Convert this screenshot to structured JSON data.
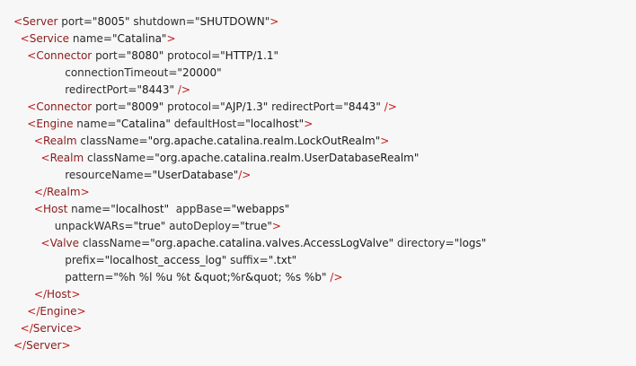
{
  "colors": {
    "background": "#f7f7f7",
    "bracket": "#c01a1a",
    "tag": "#8b1c1c",
    "attribute": "#2c2c2c",
    "value": "#1a1a1a"
  },
  "code": {
    "lines": [
      [
        {
          "t": "bracket",
          "v": "<"
        },
        {
          "t": "tag",
          "v": "Server"
        },
        {
          "t": "text",
          "v": " "
        },
        {
          "t": "attr",
          "v": "port"
        },
        {
          "t": "eq",
          "v": "="
        },
        {
          "t": "value",
          "v": "\"8005\""
        },
        {
          "t": "text",
          "v": " "
        },
        {
          "t": "attr",
          "v": "shutdown"
        },
        {
          "t": "eq",
          "v": "="
        },
        {
          "t": "value",
          "v": "\"SHUTDOWN\""
        },
        {
          "t": "bracket",
          "v": ">"
        }
      ],
      [
        {
          "t": "text",
          "v": "  "
        },
        {
          "t": "bracket",
          "v": "<"
        },
        {
          "t": "tag",
          "v": "Service"
        },
        {
          "t": "text",
          "v": " "
        },
        {
          "t": "attr",
          "v": "name"
        },
        {
          "t": "eq",
          "v": "="
        },
        {
          "t": "value",
          "v": "\"Catalina\""
        },
        {
          "t": "bracket",
          "v": ">"
        }
      ],
      [
        {
          "t": "text",
          "v": "    "
        },
        {
          "t": "bracket",
          "v": "<"
        },
        {
          "t": "tag",
          "v": "Connector"
        },
        {
          "t": "text",
          "v": " "
        },
        {
          "t": "attr",
          "v": "port"
        },
        {
          "t": "eq",
          "v": "="
        },
        {
          "t": "value",
          "v": "\"8080\""
        },
        {
          "t": "text",
          "v": " "
        },
        {
          "t": "attr",
          "v": "protocol"
        },
        {
          "t": "eq",
          "v": "="
        },
        {
          "t": "value",
          "v": "\"HTTP/1.1\""
        }
      ],
      [
        {
          "t": "text",
          "v": "               "
        },
        {
          "t": "attr",
          "v": "connectionTimeout"
        },
        {
          "t": "eq",
          "v": "="
        },
        {
          "t": "value",
          "v": "\"20000\""
        }
      ],
      [
        {
          "t": "text",
          "v": "               "
        },
        {
          "t": "attr",
          "v": "redirectPort"
        },
        {
          "t": "eq",
          "v": "="
        },
        {
          "t": "value",
          "v": "\"8443\""
        },
        {
          "t": "text",
          "v": " "
        },
        {
          "t": "bracket",
          "v": "/>"
        }
      ],
      [
        {
          "t": "text",
          "v": "    "
        },
        {
          "t": "bracket",
          "v": "<"
        },
        {
          "t": "tag",
          "v": "Connector"
        },
        {
          "t": "text",
          "v": " "
        },
        {
          "t": "attr",
          "v": "port"
        },
        {
          "t": "eq",
          "v": "="
        },
        {
          "t": "value",
          "v": "\"8009\""
        },
        {
          "t": "text",
          "v": " "
        },
        {
          "t": "attr",
          "v": "protocol"
        },
        {
          "t": "eq",
          "v": "="
        },
        {
          "t": "value",
          "v": "\"AJP/1.3\""
        },
        {
          "t": "text",
          "v": " "
        },
        {
          "t": "attr",
          "v": "redirectPort"
        },
        {
          "t": "eq",
          "v": "="
        },
        {
          "t": "value",
          "v": "\"8443\""
        },
        {
          "t": "text",
          "v": " "
        },
        {
          "t": "bracket",
          "v": "/>"
        }
      ],
      [
        {
          "t": "text",
          "v": "    "
        },
        {
          "t": "bracket",
          "v": "<"
        },
        {
          "t": "tag",
          "v": "Engine"
        },
        {
          "t": "text",
          "v": " "
        },
        {
          "t": "attr",
          "v": "name"
        },
        {
          "t": "eq",
          "v": "="
        },
        {
          "t": "value",
          "v": "\"Catalina\""
        },
        {
          "t": "text",
          "v": " "
        },
        {
          "t": "attr",
          "v": "defaultHost"
        },
        {
          "t": "eq",
          "v": "="
        },
        {
          "t": "value",
          "v": "\"localhost\""
        },
        {
          "t": "bracket",
          "v": ">"
        }
      ],
      [
        {
          "t": "text",
          "v": "      "
        },
        {
          "t": "bracket",
          "v": "<"
        },
        {
          "t": "tag",
          "v": "Realm"
        },
        {
          "t": "text",
          "v": " "
        },
        {
          "t": "attr",
          "v": "className"
        },
        {
          "t": "eq",
          "v": "="
        },
        {
          "t": "value",
          "v": "\"org.apache.catalina.realm.LockOutRealm\""
        },
        {
          "t": "bracket",
          "v": ">"
        }
      ],
      [
        {
          "t": "text",
          "v": "        "
        },
        {
          "t": "bracket",
          "v": "<"
        },
        {
          "t": "tag",
          "v": "Realm"
        },
        {
          "t": "text",
          "v": " "
        },
        {
          "t": "attr",
          "v": "className"
        },
        {
          "t": "eq",
          "v": "="
        },
        {
          "t": "value",
          "v": "\"org.apache.catalina.realm.UserDatabaseRealm\""
        }
      ],
      [
        {
          "t": "text",
          "v": "               "
        },
        {
          "t": "attr",
          "v": "resourceName"
        },
        {
          "t": "eq",
          "v": "="
        },
        {
          "t": "value",
          "v": "\"UserDatabase\""
        },
        {
          "t": "bracket",
          "v": "/>"
        }
      ],
      [
        {
          "t": "text",
          "v": "      "
        },
        {
          "t": "bracket",
          "v": "</"
        },
        {
          "t": "tag",
          "v": "Realm"
        },
        {
          "t": "bracket",
          "v": ">"
        }
      ],
      [
        {
          "t": "text",
          "v": "      "
        },
        {
          "t": "bracket",
          "v": "<"
        },
        {
          "t": "tag",
          "v": "Host"
        },
        {
          "t": "text",
          "v": " "
        },
        {
          "t": "attr",
          "v": "name"
        },
        {
          "t": "eq",
          "v": "="
        },
        {
          "t": "value",
          "v": "\"localhost\""
        },
        {
          "t": "text",
          "v": "  "
        },
        {
          "t": "attr",
          "v": "appBase"
        },
        {
          "t": "eq",
          "v": "="
        },
        {
          "t": "value",
          "v": "\"webapps\""
        }
      ],
      [
        {
          "t": "text",
          "v": "            "
        },
        {
          "t": "attr",
          "v": "unpackWARs"
        },
        {
          "t": "eq",
          "v": "="
        },
        {
          "t": "value",
          "v": "\"true\""
        },
        {
          "t": "text",
          "v": " "
        },
        {
          "t": "attr",
          "v": "autoDeploy"
        },
        {
          "t": "eq",
          "v": "="
        },
        {
          "t": "value",
          "v": "\"true\""
        },
        {
          "t": "bracket",
          "v": ">"
        }
      ],
      [
        {
          "t": "text",
          "v": "        "
        },
        {
          "t": "bracket",
          "v": "<"
        },
        {
          "t": "tag",
          "v": "Valve"
        },
        {
          "t": "text",
          "v": " "
        },
        {
          "t": "attr",
          "v": "className"
        },
        {
          "t": "eq",
          "v": "="
        },
        {
          "t": "value",
          "v": "\"org.apache.catalina.valves.AccessLogValve\""
        },
        {
          "t": "text",
          "v": " "
        },
        {
          "t": "attr",
          "v": "directory"
        },
        {
          "t": "eq",
          "v": "="
        },
        {
          "t": "value",
          "v": "\"logs\""
        }
      ],
      [
        {
          "t": "text",
          "v": "               "
        },
        {
          "t": "attr",
          "v": "prefix"
        },
        {
          "t": "eq",
          "v": "="
        },
        {
          "t": "value",
          "v": "\"localhost_access_log\""
        },
        {
          "t": "text",
          "v": " "
        },
        {
          "t": "attr",
          "v": "suffix"
        },
        {
          "t": "eq",
          "v": "="
        },
        {
          "t": "value",
          "v": "\".txt\""
        }
      ],
      [
        {
          "t": "text",
          "v": "               "
        },
        {
          "t": "attr",
          "v": "pattern"
        },
        {
          "t": "eq",
          "v": "="
        },
        {
          "t": "value",
          "v": "\"%h %l %u %t &quot;%r&quot; %s %b\""
        },
        {
          "t": "text",
          "v": " "
        },
        {
          "t": "bracket",
          "v": "/>"
        }
      ],
      [
        {
          "t": "text",
          "v": "      "
        },
        {
          "t": "bracket",
          "v": "</"
        },
        {
          "t": "tag",
          "v": "Host"
        },
        {
          "t": "bracket",
          "v": ">"
        }
      ],
      [
        {
          "t": "text",
          "v": "    "
        },
        {
          "t": "bracket",
          "v": "</"
        },
        {
          "t": "tag",
          "v": "Engine"
        },
        {
          "t": "bracket",
          "v": ">"
        }
      ],
      [
        {
          "t": "text",
          "v": "  "
        },
        {
          "t": "bracket",
          "v": "</"
        },
        {
          "t": "tag",
          "v": "Service"
        },
        {
          "t": "bracket",
          "v": ">"
        }
      ],
      [
        {
          "t": "bracket",
          "v": "</"
        },
        {
          "t": "tag",
          "v": "Server"
        },
        {
          "t": "bracket",
          "v": ">"
        }
      ]
    ]
  }
}
